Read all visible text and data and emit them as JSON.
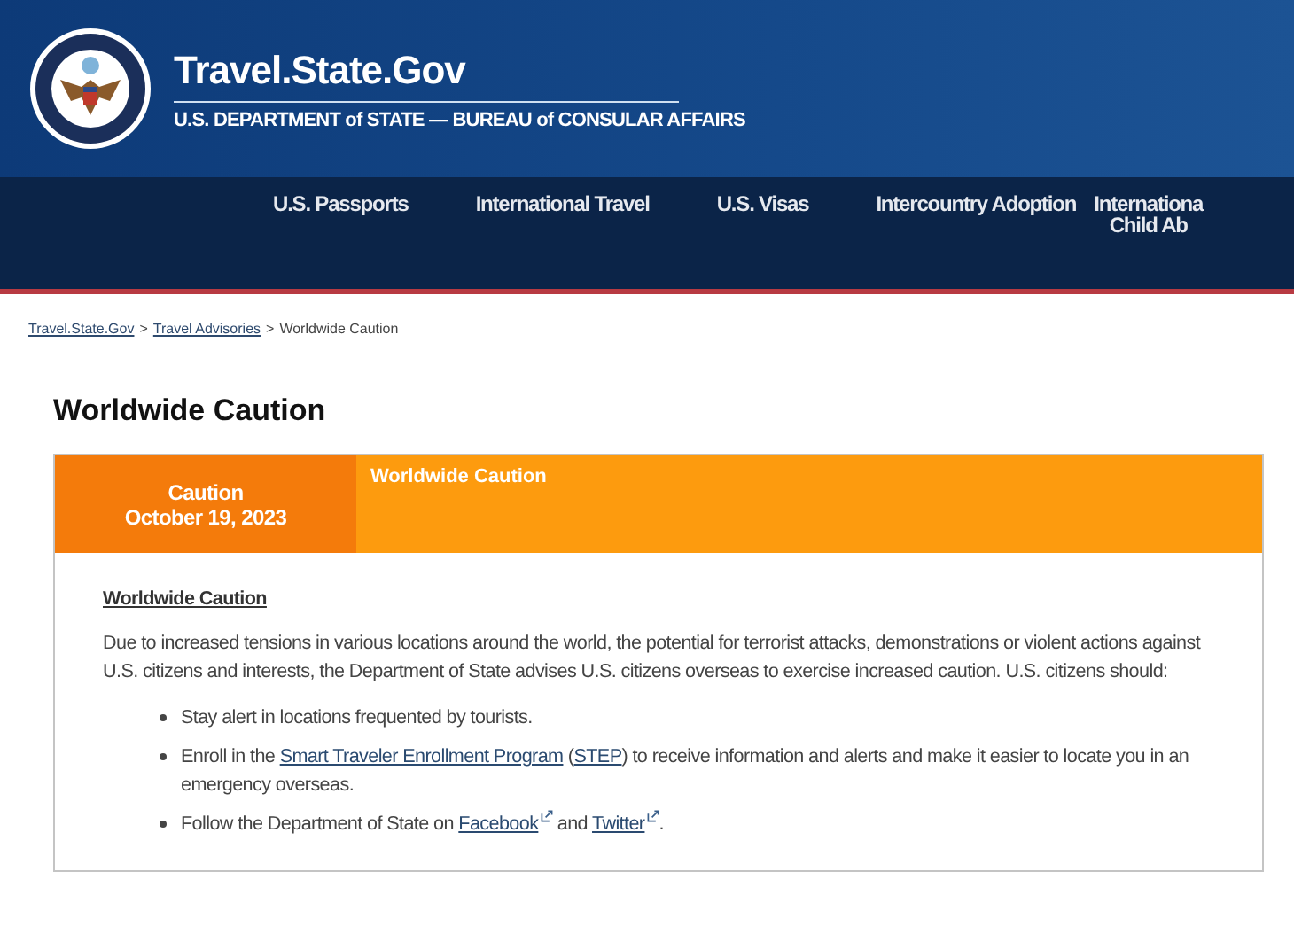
{
  "header": {
    "site_title": "Travel.State.Gov",
    "subtitle": "U.S. DEPARTMENT of STATE — BUREAU of CONSULAR AFFAIRS"
  },
  "nav": {
    "items": [
      {
        "lines": [
          "U.S. Passports"
        ]
      },
      {
        "lines": [
          "International Travel"
        ]
      },
      {
        "lines": [
          "U.S. Visas"
        ]
      },
      {
        "lines": [
          "Intercountry Adoption"
        ]
      },
      {
        "lines": [
          "Internationa",
          "Child Ab"
        ]
      }
    ]
  },
  "breadcrumb": {
    "links": [
      "Travel.State.Gov",
      "Travel Advisories"
    ],
    "separator": ">",
    "current": "Worldwide Caution"
  },
  "page_title": "Worldwide Caution",
  "alert": {
    "level": "Caution",
    "date": "October 19, 2023",
    "title": "Worldwide Caution",
    "body_heading": "Worldwide Caution",
    "paragraph": "Due to increased tensions in various locations around the world, the potential for terrorist attacks, demonstrations or violent actions against U.S. citizens and interests, the Department of State advises U.S. citizens overseas to exercise increased caution. U.S. citizens should:",
    "bullets": [
      [
        {
          "kind": "text",
          "text": "Stay alert in locations frequented by tourists."
        }
      ],
      [
        {
          "kind": "text",
          "text": "Enroll in the "
        },
        {
          "kind": "link",
          "text": "Smart Traveler Enrollment Program"
        },
        {
          "kind": "text",
          "text": " ("
        },
        {
          "kind": "link",
          "text": "STEP"
        },
        {
          "kind": "text",
          "text": ") to receive information and alerts and make it easier to locate you in an emergency overseas."
        }
      ],
      [
        {
          "kind": "text",
          "text": "Follow the Department of State on "
        },
        {
          "kind": "external_link",
          "text": "Facebook"
        },
        {
          "kind": "text",
          "text": " and "
        },
        {
          "kind": "external_link",
          "text": "Twitter"
        },
        {
          "kind": "text",
          "text": "."
        }
      ]
    ]
  }
}
